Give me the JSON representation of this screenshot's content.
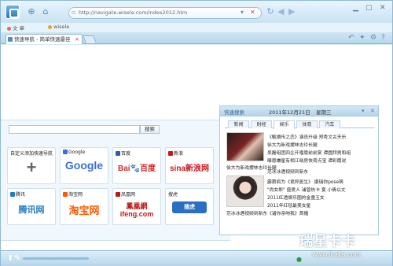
{
  "address_bar": {
    "url": "http://navigate.wisele.com/index2012.htm"
  },
  "bookmarks": [
    {
      "label": "文 章",
      "color": "#e36a6a"
    },
    {
      "label": "wisele",
      "color": "#e3a13a"
    }
  ],
  "tab": {
    "title": "快速导航 - 简单快速最佳",
    "close": "×"
  },
  "search": {
    "button_label": "搜索",
    "placeholder": ""
  },
  "tiles": [
    {
      "title": "自定义添加快速导航",
      "logo": "+",
      "color": "#555"
    },
    {
      "title": "Google",
      "logo": "Google",
      "color": "#3b6fd8"
    },
    {
      "title": "百度",
      "logo": "Bai🐾百度",
      "color": "#d12a2a"
    },
    {
      "title": "新浪",
      "logo": "sina新浪网",
      "color": "#c8161d"
    },
    {
      "title": "腾讯",
      "logo": "腾讯网",
      "color": "#1f7bc4"
    },
    {
      "title": "淘宝网",
      "logo": "淘宝网",
      "color": "#ff5a00"
    },
    {
      "title": "凤凰网",
      "logo": "鳳凰網 ifeng.com",
      "color": "#b8191e"
    },
    {
      "title": "搜虎",
      "logo": "搜虎",
      "color": "#2a70c2"
    }
  ],
  "news": {
    "header_title": "快速搜索",
    "date": "2011年12月21日",
    "weekday": "星期三",
    "tabs": [
      "新闻",
      "财经",
      "娱乐",
      "体育",
      "汽车"
    ],
    "active_tab": 2,
    "image1_caption": "徐大为新戏摆林志玲长腿",
    "image2_caption": "范冰冰遇视频到新东",
    "items": [
      "《甄嬛传之恋》演员升级 郑秀文古天乐",
      "徐大为新戏摆林志玲长腿",
      "吴磊组团四企开唱恩前前宴 谭圆拜男和组",
      "曝恩嫌星有相江晓房快荷点宝 谭彩霞说",
      "范冰冰遇视频到新东",
      "霹雳疯为《诡异医生》 摄瑞你pose萌",
      "\"尚女郎\" 盛爱人 浦曾热卡 夏 小倩以丈",
      "2011红透娱乐圈的金童玉女",
      "2011年红毯最美女星",
      "《诸你亲吻我》首播"
    ]
  },
  "watermark": {
    "text": "瑞星卡卡",
    "sub": "www.ikaka.com"
  }
}
